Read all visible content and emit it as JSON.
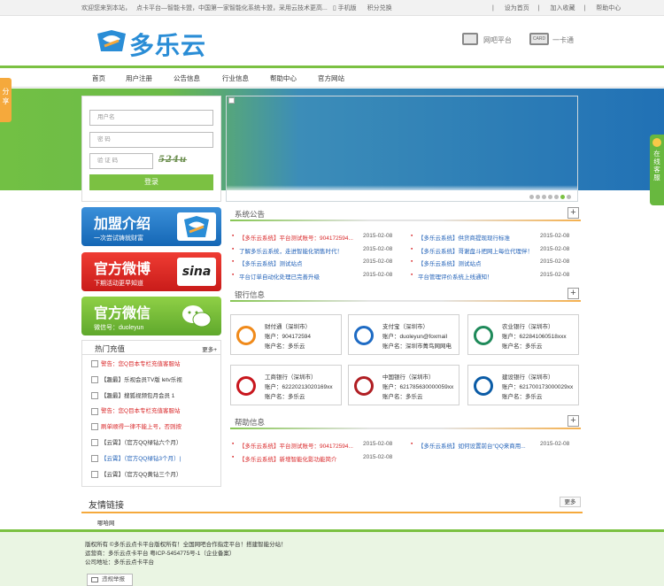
{
  "topbar": {
    "welcome": "欢迎您来到本站，",
    "desc": "点卡平台—智能卡盟，中国第一家智能化系统卡盟，采用云技术更高...",
    "mobile": "手机版",
    "points": "积分兑换",
    "homepage": "设为首页",
    "favorite": "加入收藏",
    "help": "帮助中心"
  },
  "header": {
    "logo_text": "多乐云",
    "link1": "网吧平台",
    "card_badge": "CARD",
    "link2": "一卡通"
  },
  "nav": [
    "首页",
    "用户注册",
    "公告信息",
    "行业信息",
    "帮助中心",
    "官方网站"
  ],
  "side_tab": "分享",
  "service_tab": "在线客服",
  "login": {
    "user_placeholder": "用户名",
    "pass_placeholder": "密  码",
    "captcha_placeholder": "验 证 码",
    "captcha_code": "524u",
    "button": "登录"
  },
  "promos": [
    {
      "big": "加盟介绍",
      "small": "一次尝试铸就财富"
    },
    {
      "big": "官方微博",
      "small": "下期活动更早知道",
      "icon_text": "sina"
    },
    {
      "big": "官方微信",
      "small": "微信号：duoleyun"
    }
  ],
  "hot": {
    "title": "热门充值",
    "more": "更多+",
    "items": [
      {
        "text": "警告：您Q目本专栏充值客服站",
        "color": "red"
      },
      {
        "text": "【趣最】乐视会员TV版 letv乐视",
        "color": ""
      },
      {
        "text": "【趣最】搜狐视频包月会员 1",
        "color": ""
      },
      {
        "text": "警告：您Q目本专栏充值客服站",
        "color": "red"
      },
      {
        "text": "刷单顺得一律不能上号，否则按",
        "color": "red"
      },
      {
        "text": "【云霄】（官方QQ绿钻六个月）",
        "color": ""
      },
      {
        "text": "【云霄】（官方QQ绿钻3个月）|",
        "color": "blue"
      },
      {
        "text": "【云霄】（官方QQ黄钻三个月）",
        "color": ""
      }
    ]
  },
  "notice": {
    "title": "系统公告",
    "left": [
      {
        "text": "【多乐云系统】平台测试账号：904172594...",
        "date": "2015-02-08",
        "red": true
      },
      {
        "text": "了解多乐云系统，走进智能化销售时代！",
        "date": "2015-02-08",
        "red": false
      },
      {
        "text": "【多乐云系统】测试站点",
        "date": "2015-02-08",
        "red": false
      },
      {
        "text": "平台订单自动化处理已完善升级",
        "date": "2015-02-08",
        "red": false
      }
    ],
    "right": [
      {
        "text": "【多乐云系统】供货商提现现行标准",
        "date": "2015-02-08"
      },
      {
        "text": "【多乐云系统】哥谢盘斗把网上每位代理伴！",
        "date": "2015-02-08"
      },
      {
        "text": "【多乐云系统】测试站点",
        "date": "2015-02-08"
      },
      {
        "text": "平台管理评价系统上线通知！",
        "date": "2015-02-08"
      }
    ]
  },
  "banks": {
    "title": "银行信息",
    "items": [
      {
        "name": "财付通（深圳市）",
        "acct": "账户：904172594",
        "owner": "账户名：多乐云",
        "color": "#f08a1a"
      },
      {
        "name": "支付宝（深圳市）",
        "acct": "账户：duoleyun@foxmail",
        "owner": "账户名：深圳市菁鸟网网电",
        "color": "#1e6bc4"
      },
      {
        "name": "农业银行（深圳市）",
        "acct": "账户：622841060518xxx",
        "owner": "账户名：多乐云",
        "color": "#1f8a5a"
      },
      {
        "name": "工商银行（深圳市）",
        "acct": "账户：622202130201​69xx",
        "owner": "账户名：多乐云",
        "color": "#c8161d"
      },
      {
        "name": "中国银行（深圳市）",
        "acct": "账户：621785630000059xx",
        "owner": "账户名：多乐云",
        "color": "#b01e23"
      },
      {
        "name": "建设银行（深圳市）",
        "acct": "账户：621700173000029xx",
        "owner": "账户名：多乐云",
        "color": "#0a5ba6"
      }
    ]
  },
  "helpinfo": {
    "title": "帮助信息",
    "rows": [
      {
        "left": "【多乐云系统】平台测试账号：904172594...",
        "ldate": "2015-02-08",
        "right": "【多乐云系统】如何设置前台“QQ来商用...",
        "rdate": "2015-02-08"
      },
      {
        "left": "【多乐云系统】新增智能化影功能简介",
        "ldate": "2015-02-08",
        "right": "",
        "rdate": ""
      }
    ]
  },
  "friends": {
    "title": "友情链接",
    "more": "更多",
    "link": "哪哈网"
  },
  "footer": {
    "line1": "版权所有 ©多乐云点卡平台版权所有！全国网吧合作指定平台！搭建智能分站！",
    "line2": "运营商：多乐云点卡平台 粤ICP-5454775号-1（企业备案）",
    "line3": "公司地址：多乐云点卡平台",
    "report": "违规举报"
  }
}
